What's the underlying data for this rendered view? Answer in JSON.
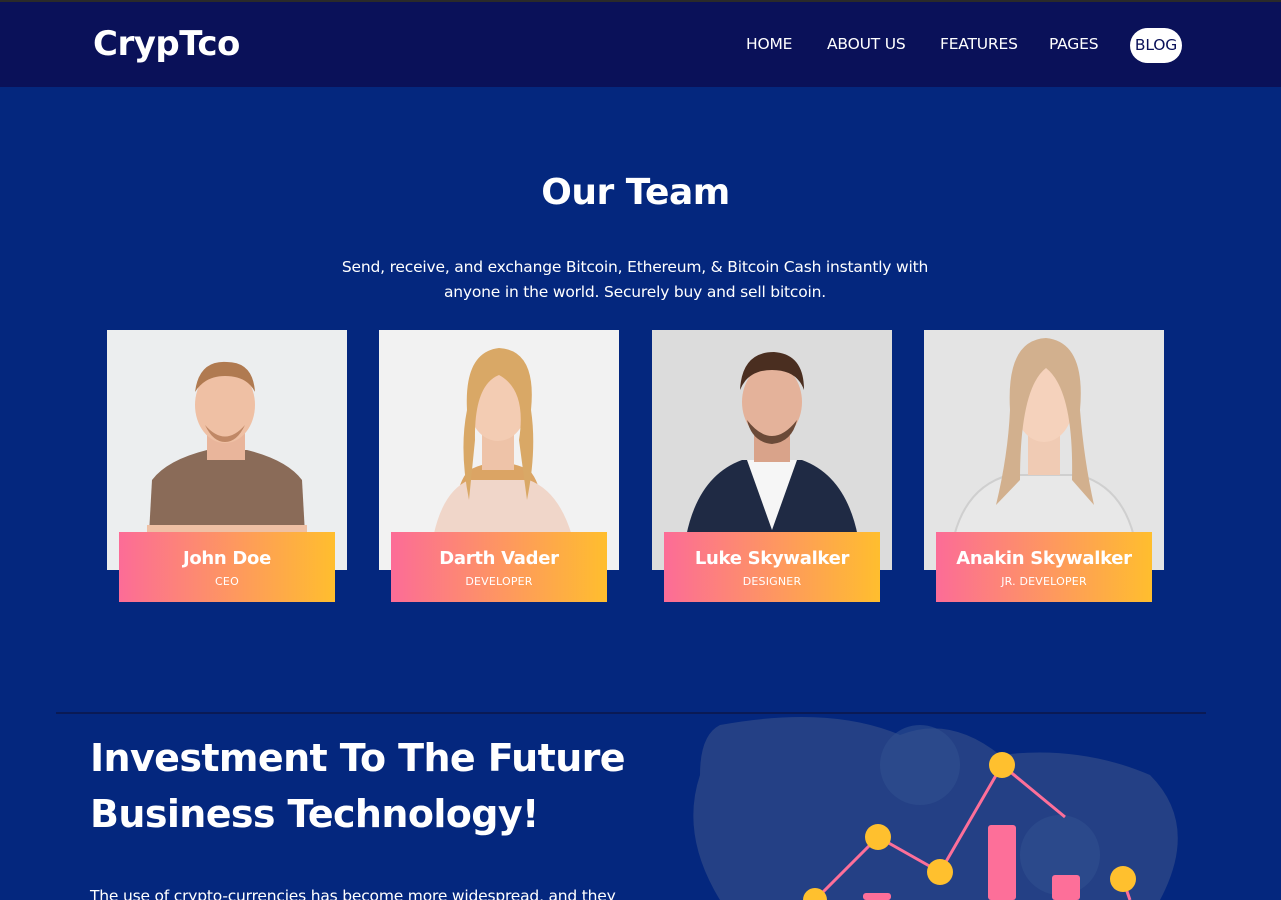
{
  "brand": {
    "logo": "CrypTco"
  },
  "nav": {
    "home": "HOME",
    "about": "ABOUT US",
    "features": "FEATURES",
    "pages": "PAGES",
    "blog": "BLOG"
  },
  "team": {
    "title": "Our Team",
    "subtitle": "Send, receive, and exchange Bitcoin, Ethereum, & Bitcoin Cash instantly with anyone in the world. Securely buy and sell bitcoin.",
    "members": [
      {
        "name": "John Doe",
        "role": "CEO"
      },
      {
        "name": "Darth Vader",
        "role": "DEVELOPER"
      },
      {
        "name": "Luke Skywalker",
        "role": "DESIGNER"
      },
      {
        "name": "Anakin Skywalker",
        "role": "JR. DEVELOPER"
      }
    ]
  },
  "investment": {
    "title_line1": "Investment To The Future",
    "title_line2": "Business Technology!",
    "text": "The use of crypto-currencies has become more widespread, and they"
  },
  "colors": {
    "background": "#04277e",
    "header": "#0a1159",
    "gradient_start": "#fc6c97",
    "gradient_end": "#ffbe2e",
    "accent_yellow": "#ffc02e",
    "accent_pink": "#fd6f99"
  }
}
